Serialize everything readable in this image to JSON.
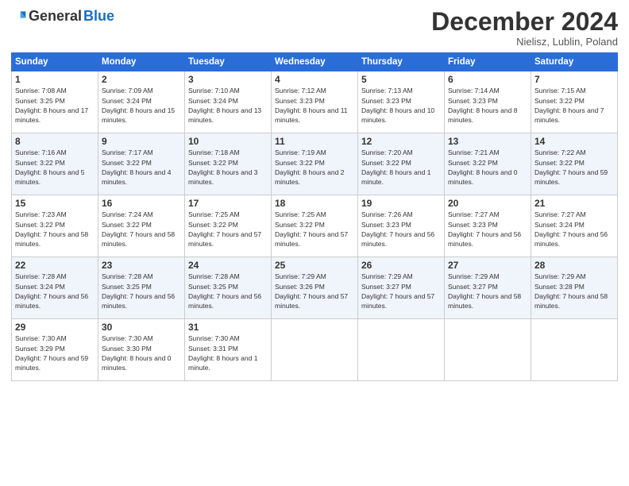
{
  "logo": {
    "general": "General",
    "blue": "Blue"
  },
  "header": {
    "month": "December 2024",
    "location": "Nielisz, Lublin, Poland"
  },
  "days_of_week": [
    "Sunday",
    "Monday",
    "Tuesday",
    "Wednesday",
    "Thursday",
    "Friday",
    "Saturday"
  ],
  "weeks": [
    [
      {
        "day": "1",
        "sunrise": "7:08 AM",
        "sunset": "3:25 PM",
        "daylight": "8 hours and 17 minutes."
      },
      {
        "day": "2",
        "sunrise": "7:09 AM",
        "sunset": "3:24 PM",
        "daylight": "8 hours and 15 minutes."
      },
      {
        "day": "3",
        "sunrise": "7:10 AM",
        "sunset": "3:24 PM",
        "daylight": "8 hours and 13 minutes."
      },
      {
        "day": "4",
        "sunrise": "7:12 AM",
        "sunset": "3:23 PM",
        "daylight": "8 hours and 11 minutes."
      },
      {
        "day": "5",
        "sunrise": "7:13 AM",
        "sunset": "3:23 PM",
        "daylight": "8 hours and 10 minutes."
      },
      {
        "day": "6",
        "sunrise": "7:14 AM",
        "sunset": "3:23 PM",
        "daylight": "8 hours and 8 minutes."
      },
      {
        "day": "7",
        "sunrise": "7:15 AM",
        "sunset": "3:22 PM",
        "daylight": "8 hours and 7 minutes."
      }
    ],
    [
      {
        "day": "8",
        "sunrise": "7:16 AM",
        "sunset": "3:22 PM",
        "daylight": "8 hours and 5 minutes."
      },
      {
        "day": "9",
        "sunrise": "7:17 AM",
        "sunset": "3:22 PM",
        "daylight": "8 hours and 4 minutes."
      },
      {
        "day": "10",
        "sunrise": "7:18 AM",
        "sunset": "3:22 PM",
        "daylight": "8 hours and 3 minutes."
      },
      {
        "day": "11",
        "sunrise": "7:19 AM",
        "sunset": "3:22 PM",
        "daylight": "8 hours and 2 minutes."
      },
      {
        "day": "12",
        "sunrise": "7:20 AM",
        "sunset": "3:22 PM",
        "daylight": "8 hours and 1 minute."
      },
      {
        "day": "13",
        "sunrise": "7:21 AM",
        "sunset": "3:22 PM",
        "daylight": "8 hours and 0 minutes."
      },
      {
        "day": "14",
        "sunrise": "7:22 AM",
        "sunset": "3:22 PM",
        "daylight": "7 hours and 59 minutes."
      }
    ],
    [
      {
        "day": "15",
        "sunrise": "7:23 AM",
        "sunset": "3:22 PM",
        "daylight": "7 hours and 58 minutes."
      },
      {
        "day": "16",
        "sunrise": "7:24 AM",
        "sunset": "3:22 PM",
        "daylight": "7 hours and 58 minutes."
      },
      {
        "day": "17",
        "sunrise": "7:25 AM",
        "sunset": "3:22 PM",
        "daylight": "7 hours and 57 minutes."
      },
      {
        "day": "18",
        "sunrise": "7:25 AM",
        "sunset": "3:22 PM",
        "daylight": "7 hours and 57 minutes."
      },
      {
        "day": "19",
        "sunrise": "7:26 AM",
        "sunset": "3:23 PM",
        "daylight": "7 hours and 56 minutes."
      },
      {
        "day": "20",
        "sunrise": "7:27 AM",
        "sunset": "3:23 PM",
        "daylight": "7 hours and 56 minutes."
      },
      {
        "day": "21",
        "sunrise": "7:27 AM",
        "sunset": "3:24 PM",
        "daylight": "7 hours and 56 minutes."
      }
    ],
    [
      {
        "day": "22",
        "sunrise": "7:28 AM",
        "sunset": "3:24 PM",
        "daylight": "7 hours and 56 minutes."
      },
      {
        "day": "23",
        "sunrise": "7:28 AM",
        "sunset": "3:25 PM",
        "daylight": "7 hours and 56 minutes."
      },
      {
        "day": "24",
        "sunrise": "7:28 AM",
        "sunset": "3:25 PM",
        "daylight": "7 hours and 56 minutes."
      },
      {
        "day": "25",
        "sunrise": "7:29 AM",
        "sunset": "3:26 PM",
        "daylight": "7 hours and 57 minutes."
      },
      {
        "day": "26",
        "sunrise": "7:29 AM",
        "sunset": "3:27 PM",
        "daylight": "7 hours and 57 minutes."
      },
      {
        "day": "27",
        "sunrise": "7:29 AM",
        "sunset": "3:27 PM",
        "daylight": "7 hours and 58 minutes."
      },
      {
        "day": "28",
        "sunrise": "7:29 AM",
        "sunset": "3:28 PM",
        "daylight": "7 hours and 58 minutes."
      }
    ],
    [
      {
        "day": "29",
        "sunrise": "7:30 AM",
        "sunset": "3:29 PM",
        "daylight": "7 hours and 59 minutes."
      },
      {
        "day": "30",
        "sunrise": "7:30 AM",
        "sunset": "3:30 PM",
        "daylight": "8 hours and 0 minutes."
      },
      {
        "day": "31",
        "sunrise": "7:30 AM",
        "sunset": "3:31 PM",
        "daylight": "8 hours and 1 minute."
      },
      null,
      null,
      null,
      null
    ]
  ]
}
